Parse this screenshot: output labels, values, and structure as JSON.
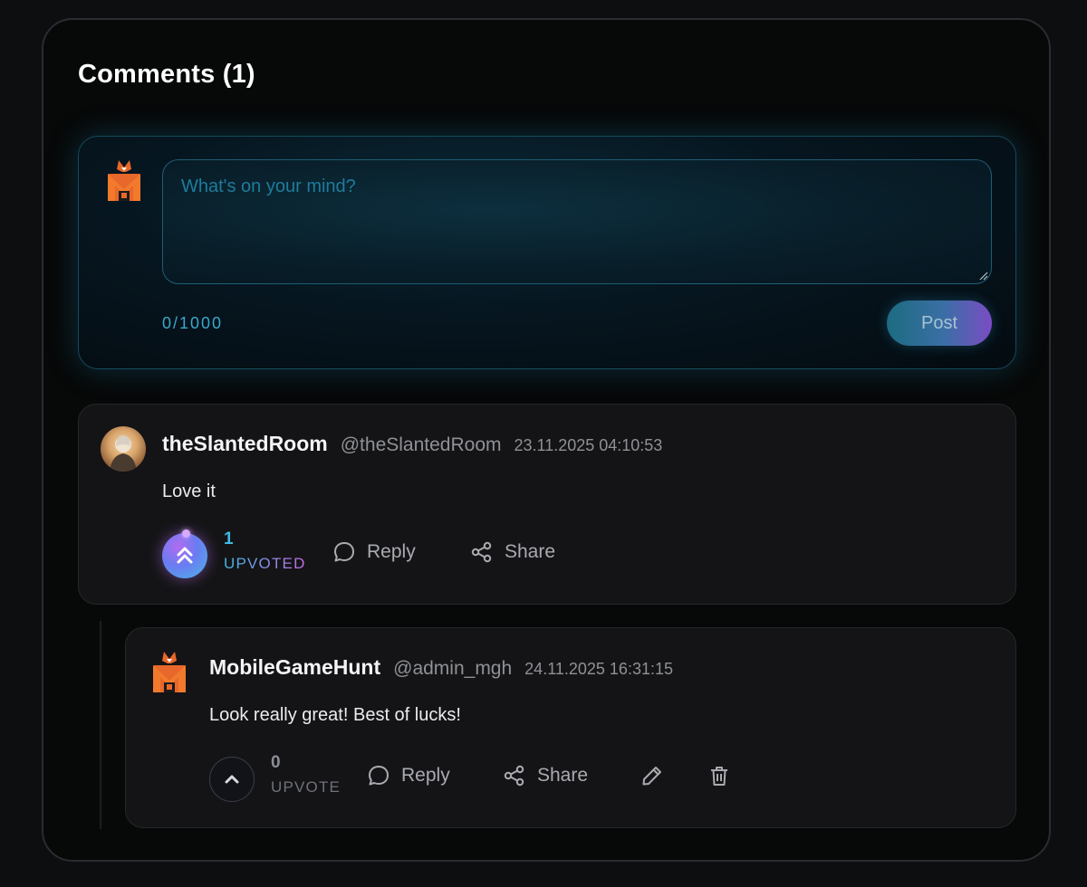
{
  "section": {
    "title": "Comments (1)"
  },
  "composer": {
    "placeholder": "What's on your mind?",
    "value": "",
    "counter": "0/1000",
    "post_label": "Post",
    "avatar_icon": "mobilegamehunt-logo"
  },
  "comments": [
    {
      "author": "theSlantedRoom",
      "handle": "@theSlantedRoom",
      "timestamp": "23.11.2025 04:10:53",
      "body": "Love it",
      "votes": "1",
      "vote_state_label": "UPVOTED",
      "reply_label": "Reply",
      "share_label": "Share",
      "avatar_icon": "user-photo"
    },
    {
      "author": "MobileGameHunt",
      "handle": "@admin_mgh",
      "timestamp": "24.11.2025 16:31:15",
      "body": "Look really great! Best of lucks!",
      "votes": "0",
      "vote_state_label": "UPVOTE",
      "reply_label": "Reply",
      "share_label": "Share",
      "avatar_icon": "mobilegamehunt-logo",
      "is_reply": true
    }
  ],
  "colors": {
    "accent_cyan": "#40b9e6",
    "accent_purple": "#c76ae8",
    "panel_bg": "#070808",
    "card_bg": "#141416"
  }
}
